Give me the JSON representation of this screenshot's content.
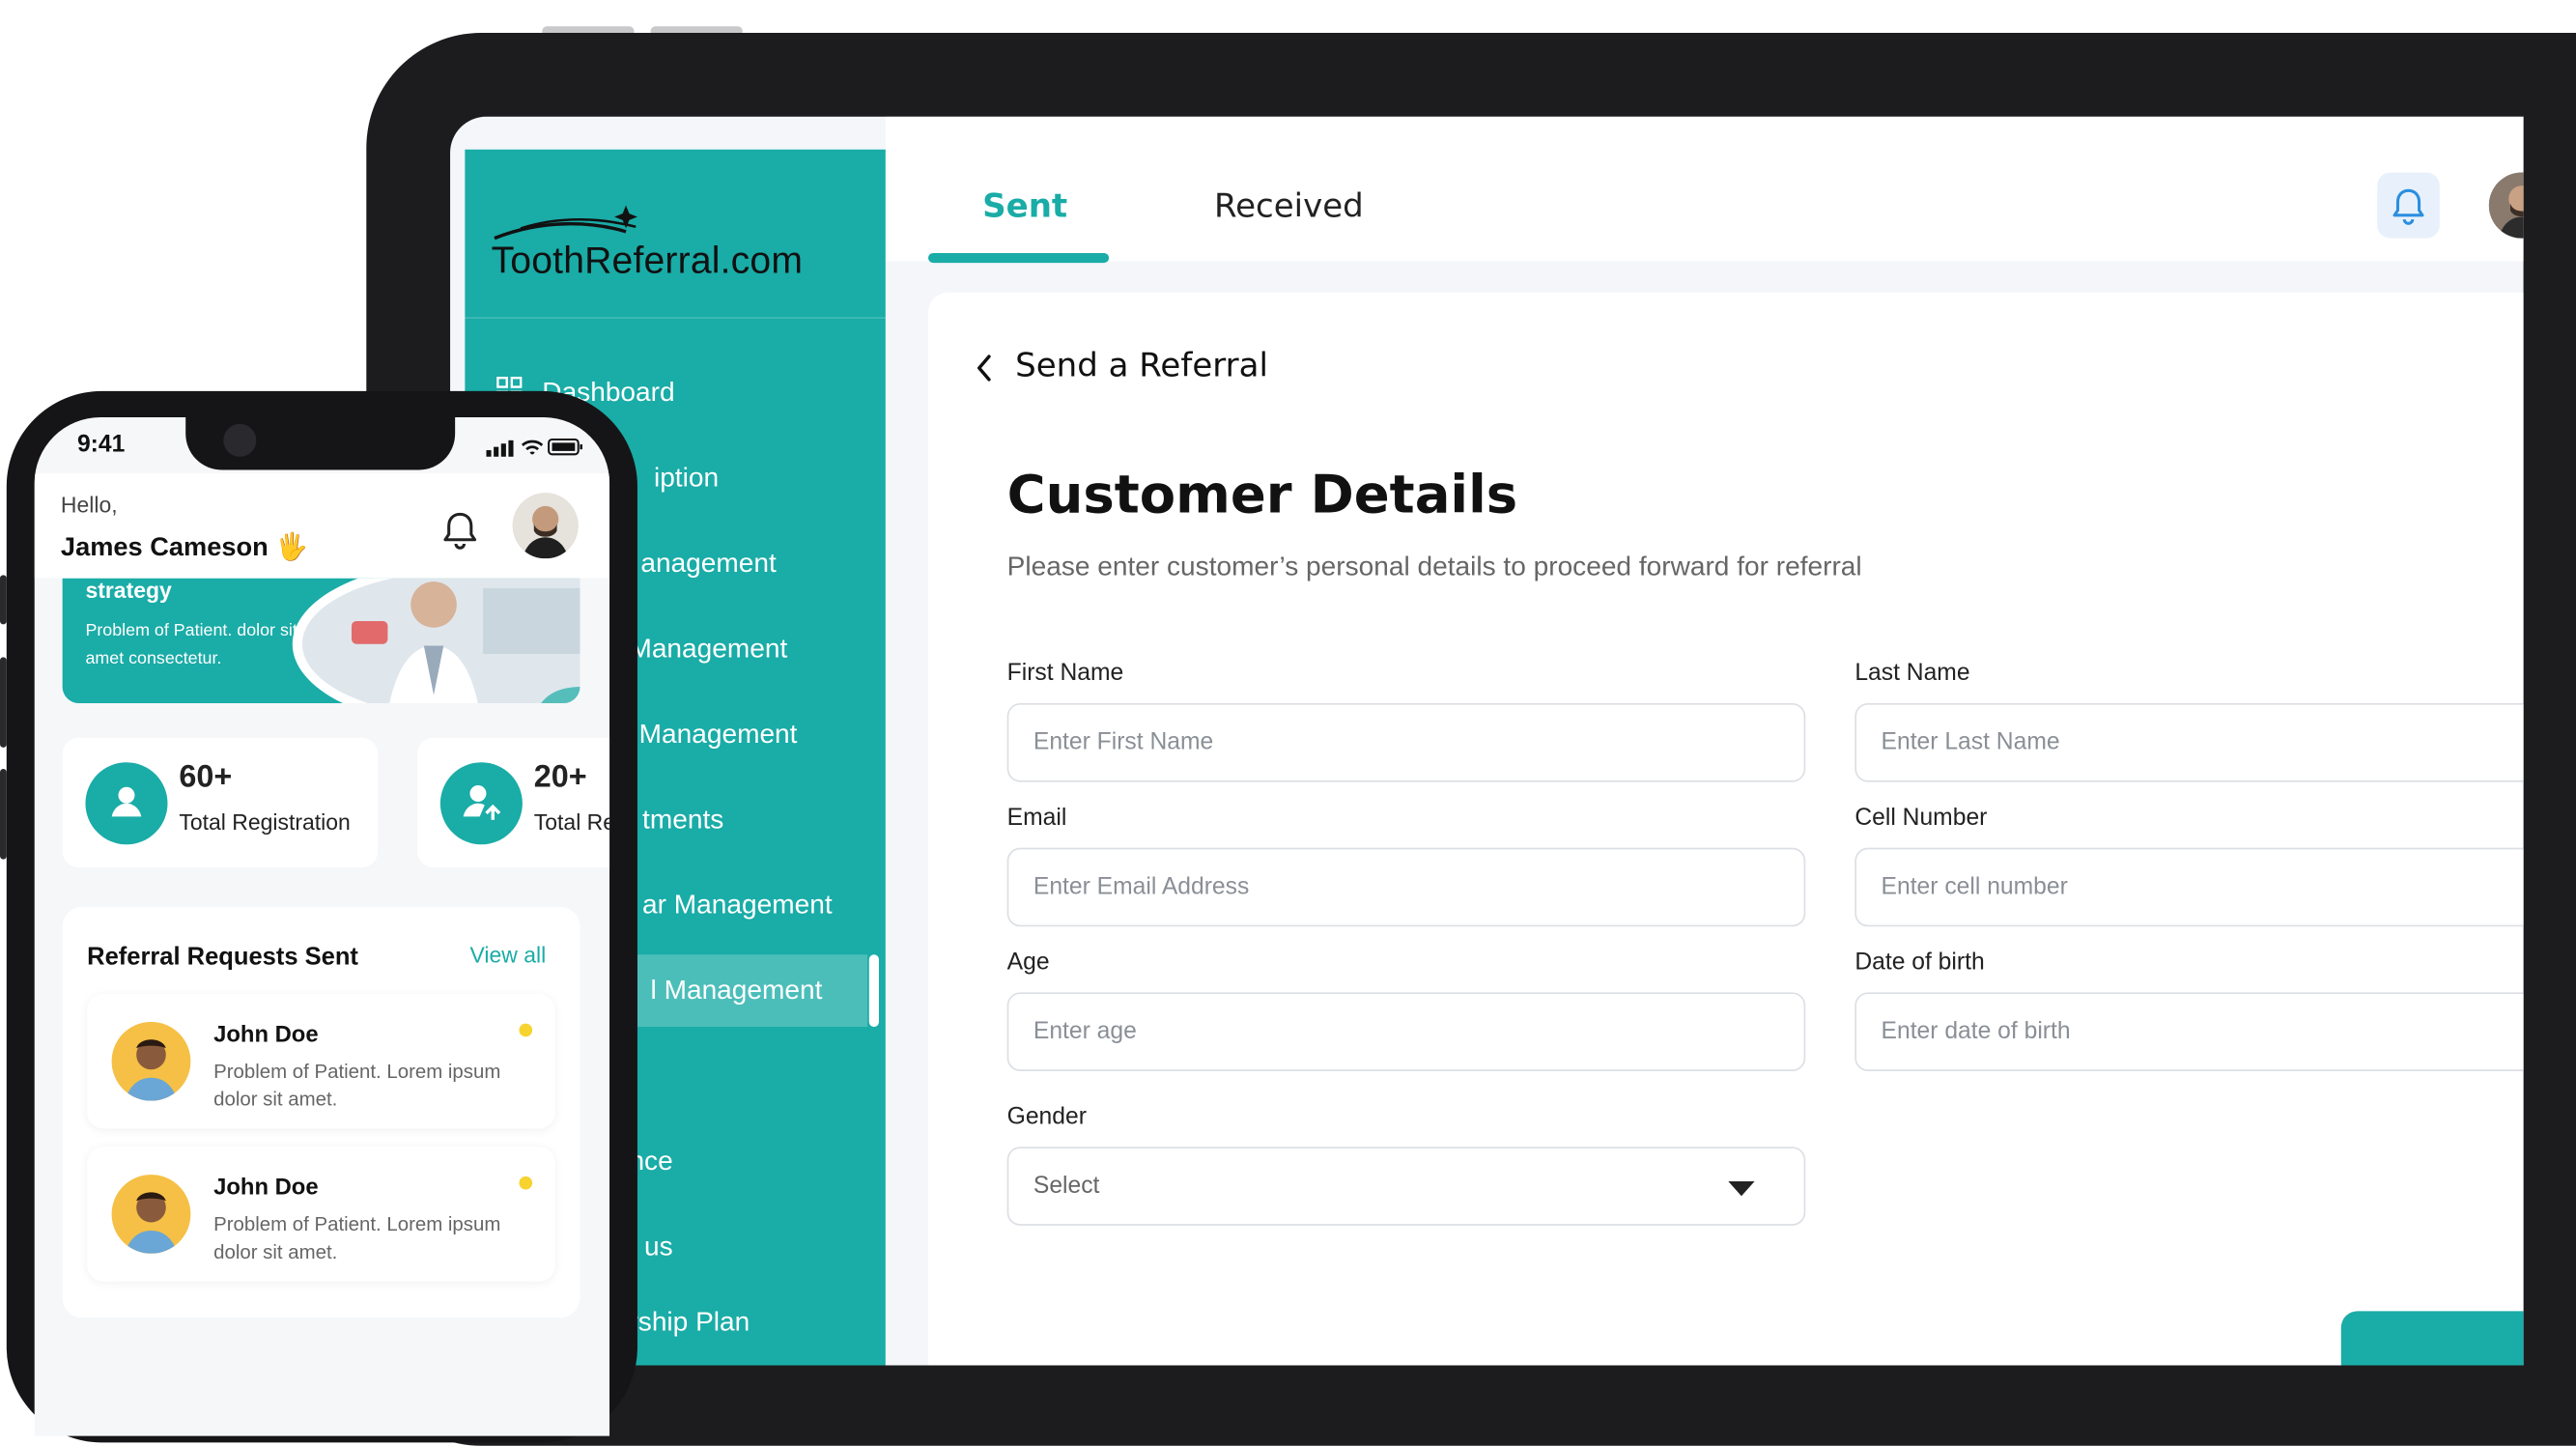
{
  "tablet": {
    "tabs": {
      "sent": "Sent",
      "received": "Received"
    },
    "brand": {
      "logo_text": "ToothReferral.com"
    },
    "sidebar": {
      "items": [
        {
          "label": "Dashboard"
        },
        {
          "label": "iption"
        },
        {
          "label": "anagement"
        },
        {
          "label": " Management"
        },
        {
          "label": "Management"
        },
        {
          "label": "tments"
        },
        {
          "label": "ar Management"
        },
        {
          "label": "l Management"
        },
        {
          "label": "nce"
        },
        {
          "label": "t us"
        },
        {
          "label": "rship Plan"
        }
      ]
    },
    "form": {
      "back_label": "Send a Referral",
      "title": "Customer Details",
      "subtitle": "Please enter customer’s personal details to proceed forward for referral",
      "first_name": {
        "label": "First Name",
        "placeholder": "Enter First Name"
      },
      "last_name": {
        "label": "Last Name",
        "placeholder": "Enter Last Name"
      },
      "email": {
        "label": "Email",
        "placeholder": "Enter Email Address"
      },
      "cell": {
        "label": "Cell Number",
        "placeholder": "Enter cell number"
      },
      "age": {
        "label": "Age",
        "placeholder": "Enter age"
      },
      "dob": {
        "label": "Date of birth",
        "placeholder": "Enter date of birth"
      },
      "gender": {
        "label": "Gender",
        "value": "Select"
      }
    },
    "icons": [
      "bell-icon",
      "chevron-left-icon",
      "grid-icon",
      "caret-down-icon"
    ]
  },
  "phone": {
    "status_time": "9:41",
    "greeting": "Hello,",
    "user_name": "James Cameson 🖐",
    "banner": {
      "title": "strategy",
      "text": "Problem of Patient. dolor sit amet consectetur."
    },
    "stats": [
      {
        "value": "60+",
        "label": "Total Registration"
      },
      {
        "value": "20+",
        "label": "Total Referral Appointments"
      }
    ],
    "referrals": {
      "title": "Referral Requests Sent",
      "view_all": "View all",
      "items": [
        {
          "name": "John Doe",
          "text": "Problem of Patient. Lorem ipsum dolor sit amet."
        },
        {
          "name": "John Doe",
          "text": "Problem of Patient. Lorem ipsum dolor sit amet."
        }
      ]
    }
  },
  "colors": {
    "accent": "#1aaca7",
    "device": "#1c1c1e",
    "background": "#ffffff",
    "status_dot": "#f6d32f"
  }
}
